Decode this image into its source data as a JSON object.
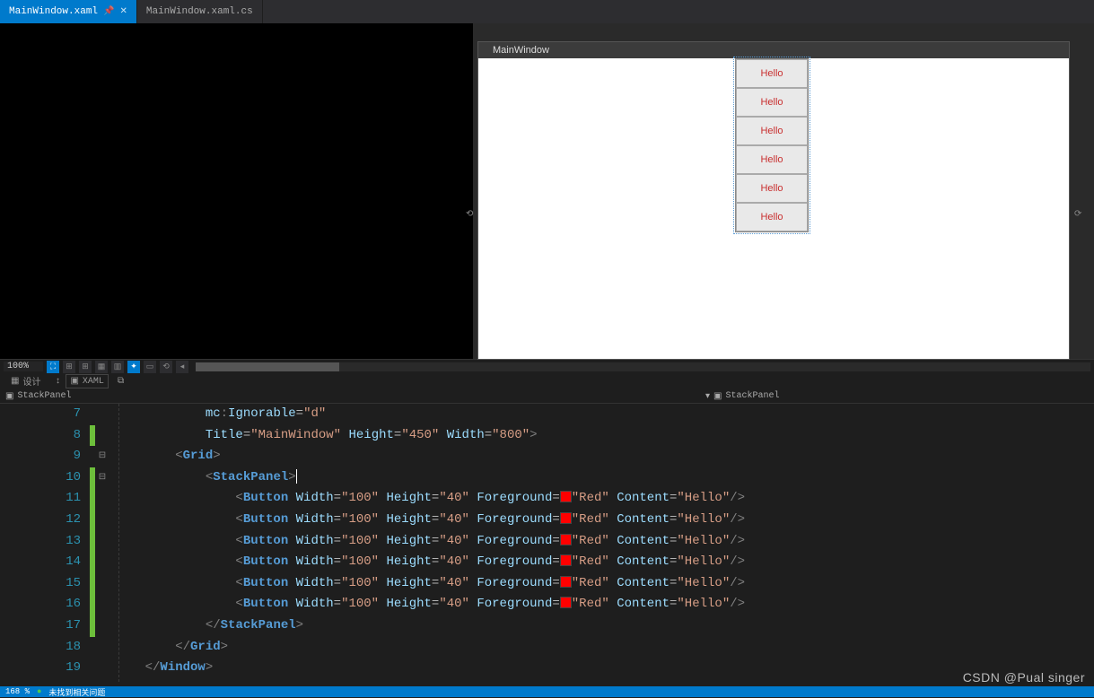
{
  "tabs": [
    {
      "label": "MainWindow.xaml",
      "active": true,
      "pinned": true
    },
    {
      "label": "MainWindow.xaml.cs",
      "active": false,
      "pinned": false
    }
  ],
  "preview": {
    "title": "MainWindow",
    "buttons": [
      "Hello",
      "Hello",
      "Hello",
      "Hello",
      "Hello",
      "Hello"
    ]
  },
  "toolbar": {
    "zoom": "100%"
  },
  "paneTabs": {
    "design": "设计",
    "xaml": "XAML"
  },
  "breadcrumb": {
    "left": "StackPanel",
    "right": "StackPanel"
  },
  "code": {
    "firstLine": 7,
    "lines": [
      {
        "n": 7,
        "changed": false,
        "indent": 3,
        "segs": [
          [
            "attr",
            "mc"
          ],
          [
            "punct",
            ":"
          ],
          [
            "attr",
            "Ignorable"
          ],
          [
            "eq",
            "="
          ],
          [
            "str",
            "\"d\""
          ]
        ]
      },
      {
        "n": 8,
        "changed": true,
        "indent": 3,
        "segs": [
          [
            "attr",
            "Title"
          ],
          [
            "eq",
            "="
          ],
          [
            "str",
            "\"MainWindow\""
          ],
          [
            "txt",
            " "
          ],
          [
            "attr",
            "Height"
          ],
          [
            "eq",
            "="
          ],
          [
            "str",
            "\"450\""
          ],
          [
            "txt",
            " "
          ],
          [
            "attr",
            "Width"
          ],
          [
            "eq",
            "="
          ],
          [
            "str",
            "\"800\""
          ],
          [
            "punct",
            ">"
          ]
        ]
      },
      {
        "n": 9,
        "changed": false,
        "indent": 2,
        "fold": "-",
        "segs": [
          [
            "punct",
            "<"
          ],
          [
            "tag",
            "Grid"
          ],
          [
            "punct",
            ">"
          ]
        ]
      },
      {
        "n": 10,
        "changed": true,
        "indent": 3,
        "fold": "-",
        "sel": "open",
        "segs": [
          [
            "punct",
            "<"
          ],
          [
            "tag",
            "StackPanel"
          ],
          [
            "punct",
            ">"
          ]
        ]
      },
      {
        "n": 11,
        "changed": true,
        "indent": 4,
        "segs": [
          [
            "punct",
            "<"
          ],
          [
            "tag",
            "Button"
          ],
          [
            "txt",
            " "
          ],
          [
            "attr",
            "Width"
          ],
          [
            "eq",
            "="
          ],
          [
            "str",
            "\"100\""
          ],
          [
            "txt",
            " "
          ],
          [
            "attr",
            "Height"
          ],
          [
            "eq",
            "="
          ],
          [
            "str",
            "\"40\""
          ],
          [
            "txt",
            " "
          ],
          [
            "attr",
            "Foreground"
          ],
          [
            "eq",
            "="
          ],
          [
            "swatch",
            ""
          ],
          [
            "str",
            "\"Red\""
          ],
          [
            "txt",
            " "
          ],
          [
            "attr",
            "Content"
          ],
          [
            "eq",
            "="
          ],
          [
            "str",
            "\"Hello\""
          ],
          [
            "punct",
            "/>"
          ]
        ]
      },
      {
        "n": 12,
        "changed": true,
        "indent": 4,
        "segs": [
          [
            "punct",
            "<"
          ],
          [
            "tag",
            "Button"
          ],
          [
            "txt",
            " "
          ],
          [
            "attr",
            "Width"
          ],
          [
            "eq",
            "="
          ],
          [
            "str",
            "\"100\""
          ],
          [
            "txt",
            " "
          ],
          [
            "attr",
            "Height"
          ],
          [
            "eq",
            "="
          ],
          [
            "str",
            "\"40\""
          ],
          [
            "txt",
            " "
          ],
          [
            "attr",
            "Foreground"
          ],
          [
            "eq",
            "="
          ],
          [
            "swatch",
            ""
          ],
          [
            "str",
            "\"Red\""
          ],
          [
            "txt",
            " "
          ],
          [
            "attr",
            "Content"
          ],
          [
            "eq",
            "="
          ],
          [
            "str",
            "\"Hello\""
          ],
          [
            "punct",
            "/>"
          ]
        ]
      },
      {
        "n": 13,
        "changed": true,
        "indent": 4,
        "segs": [
          [
            "punct",
            "<"
          ],
          [
            "tag",
            "Button"
          ],
          [
            "txt",
            " "
          ],
          [
            "attr",
            "Width"
          ],
          [
            "eq",
            "="
          ],
          [
            "str",
            "\"100\""
          ],
          [
            "txt",
            " "
          ],
          [
            "attr",
            "Height"
          ],
          [
            "eq",
            "="
          ],
          [
            "str",
            "\"40\""
          ],
          [
            "txt",
            " "
          ],
          [
            "attr",
            "Foreground"
          ],
          [
            "eq",
            "="
          ],
          [
            "swatch",
            ""
          ],
          [
            "str",
            "\"Red\""
          ],
          [
            "txt",
            " "
          ],
          [
            "attr",
            "Content"
          ],
          [
            "eq",
            "="
          ],
          [
            "str",
            "\"Hello\""
          ],
          [
            "punct",
            "/>"
          ]
        ]
      },
      {
        "n": 14,
        "changed": true,
        "indent": 4,
        "segs": [
          [
            "punct",
            "<"
          ],
          [
            "tag",
            "Button"
          ],
          [
            "txt",
            " "
          ],
          [
            "attr",
            "Width"
          ],
          [
            "eq",
            "="
          ],
          [
            "str",
            "\"100\""
          ],
          [
            "txt",
            " "
          ],
          [
            "attr",
            "Height"
          ],
          [
            "eq",
            "="
          ],
          [
            "str",
            "\"40\""
          ],
          [
            "txt",
            " "
          ],
          [
            "attr",
            "Foreground"
          ],
          [
            "eq",
            "="
          ],
          [
            "swatch",
            ""
          ],
          [
            "str",
            "\"Red\""
          ],
          [
            "txt",
            " "
          ],
          [
            "attr",
            "Content"
          ],
          [
            "eq",
            "="
          ],
          [
            "str",
            "\"Hello\""
          ],
          [
            "punct",
            "/>"
          ]
        ]
      },
      {
        "n": 15,
        "changed": true,
        "indent": 4,
        "segs": [
          [
            "punct",
            "<"
          ],
          [
            "tag",
            "Button"
          ],
          [
            "txt",
            " "
          ],
          [
            "attr",
            "Width"
          ],
          [
            "eq",
            "="
          ],
          [
            "str",
            "\"100\""
          ],
          [
            "txt",
            " "
          ],
          [
            "attr",
            "Height"
          ],
          [
            "eq",
            "="
          ],
          [
            "str",
            "\"40\""
          ],
          [
            "txt",
            " "
          ],
          [
            "attr",
            "Foreground"
          ],
          [
            "eq",
            "="
          ],
          [
            "swatch",
            ""
          ],
          [
            "str",
            "\"Red\""
          ],
          [
            "txt",
            " "
          ],
          [
            "attr",
            "Content"
          ],
          [
            "eq",
            "="
          ],
          [
            "str",
            "\"Hello\""
          ],
          [
            "punct",
            "/>"
          ]
        ]
      },
      {
        "n": 16,
        "changed": true,
        "indent": 4,
        "segs": [
          [
            "punct",
            "<"
          ],
          [
            "tag",
            "Button"
          ],
          [
            "txt",
            " "
          ],
          [
            "attr",
            "Width"
          ],
          [
            "eq",
            "="
          ],
          [
            "str",
            "\"100\""
          ],
          [
            "txt",
            " "
          ],
          [
            "attr",
            "Height"
          ],
          [
            "eq",
            "="
          ],
          [
            "str",
            "\"40\""
          ],
          [
            "txt",
            " "
          ],
          [
            "attr",
            "Foreground"
          ],
          [
            "eq",
            "="
          ],
          [
            "swatch",
            ""
          ],
          [
            "str",
            "\"Red\""
          ],
          [
            "txt",
            " "
          ],
          [
            "attr",
            "Content"
          ],
          [
            "eq",
            "="
          ],
          [
            "str",
            "\"Hello\""
          ],
          [
            "punct",
            "/>"
          ]
        ]
      },
      {
        "n": 17,
        "changed": true,
        "indent": 3,
        "sel": "close",
        "segs": [
          [
            "punct",
            "</"
          ],
          [
            "tag",
            "StackPanel"
          ],
          [
            "punct",
            ">"
          ]
        ]
      },
      {
        "n": 18,
        "changed": false,
        "indent": 2,
        "segs": [
          [
            "punct",
            "</"
          ],
          [
            "tag",
            "Grid"
          ],
          [
            "punct",
            ">"
          ]
        ]
      },
      {
        "n": 19,
        "changed": false,
        "indent": 1,
        "segs": [
          [
            "punct",
            "</"
          ],
          [
            "tag",
            "Window"
          ],
          [
            "punct",
            ">"
          ]
        ]
      }
    ]
  },
  "status": {
    "zoom": "168 %",
    "message": "未找到相关问题"
  },
  "watermark": "CSDN @Pual singer"
}
